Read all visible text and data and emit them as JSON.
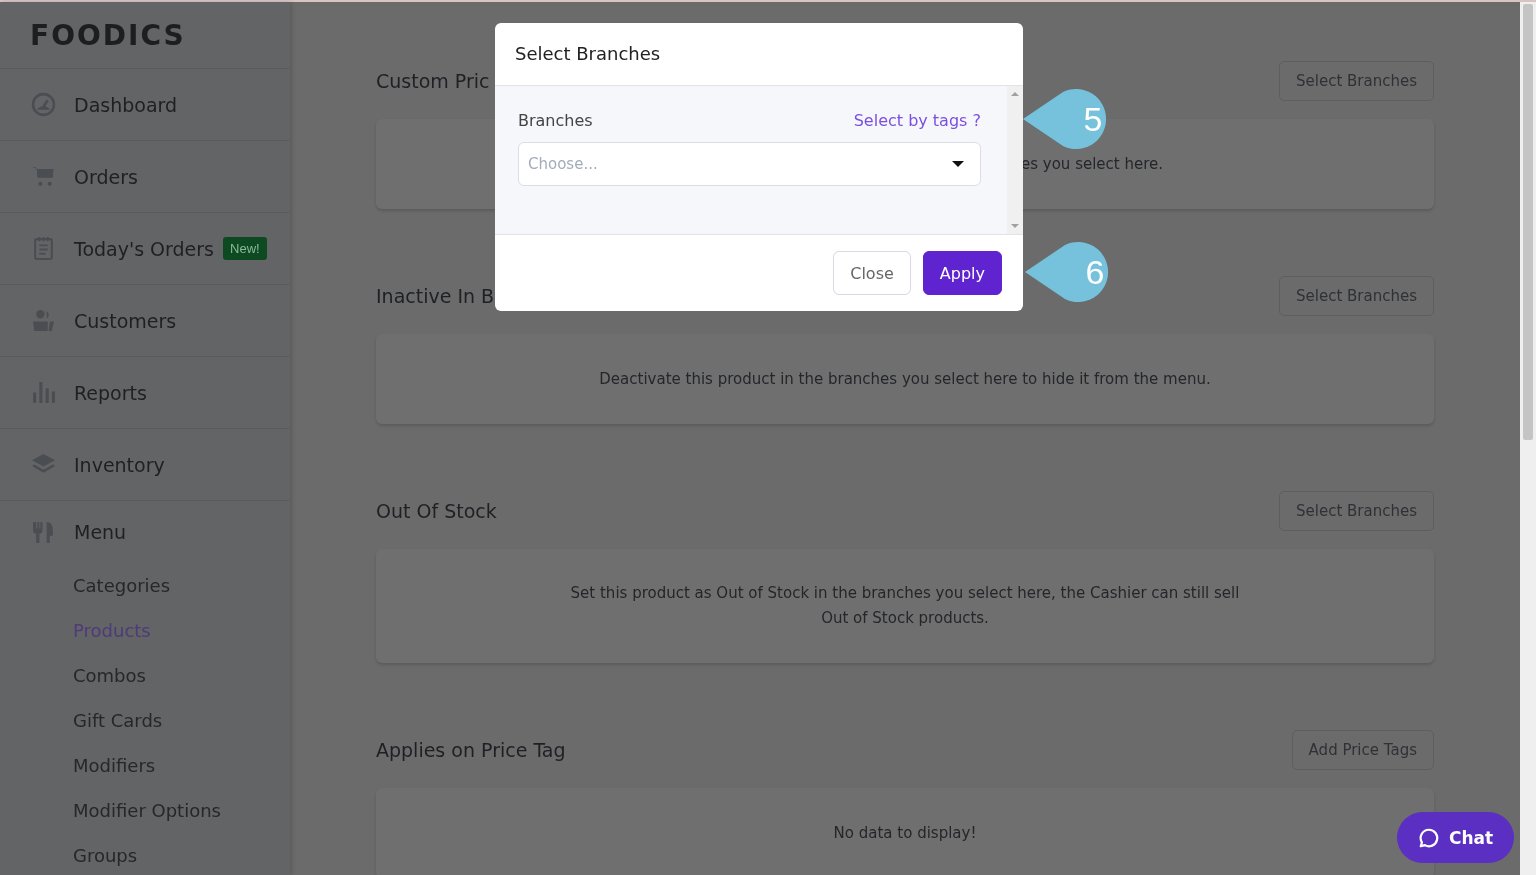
{
  "sidebar": {
    "logo": "FOODICS",
    "items": [
      {
        "label": "Dashboard"
      },
      {
        "label": "Orders"
      },
      {
        "label": "Today's Orders",
        "badge": "New!"
      },
      {
        "label": "Customers"
      },
      {
        "label": "Reports"
      },
      {
        "label": "Inventory"
      },
      {
        "label": "Menu",
        "expanded": true,
        "children": [
          {
            "label": "Categories",
            "selected": false
          },
          {
            "label": "Products",
            "selected": true
          },
          {
            "label": "Combos",
            "selected": false
          },
          {
            "label": "Gift Cards",
            "selected": false
          },
          {
            "label": "Modifiers",
            "selected": false
          },
          {
            "label": "Modifier Options",
            "selected": false
          },
          {
            "label": "Groups",
            "selected": false
          }
        ]
      }
    ]
  },
  "sections": [
    {
      "kind": "covered",
      "title": "Custom Pric",
      "button": "Select Branches",
      "message": "es you select here."
    },
    {
      "kind": "covered",
      "title": "Inactive In B",
      "button": "Select Branches",
      "message": "Deactivate this product in the branches you select here to hide it from the menu."
    },
    {
      "kind": "plain",
      "title": "Out Of Stock",
      "button": "Select Branches",
      "message": "Set this product as Out of Stock in the branches you select here, the Cashier can still sell Out of Stock products."
    },
    {
      "kind": "plain",
      "title": "Applies on Price Tag",
      "button": "Add Price Tags",
      "message": "No data to display!"
    }
  ],
  "modal": {
    "title": "Select Branches",
    "field_label": "Branches",
    "link": "Select by tags ?",
    "placeholder": "Choose...",
    "buttons": [
      {
        "label": "Close",
        "kind": "secondary"
      },
      {
        "label": "Apply",
        "kind": "primary"
      }
    ]
  },
  "callouts": [
    "5",
    "6"
  ],
  "chat": {
    "label": "Chat"
  }
}
